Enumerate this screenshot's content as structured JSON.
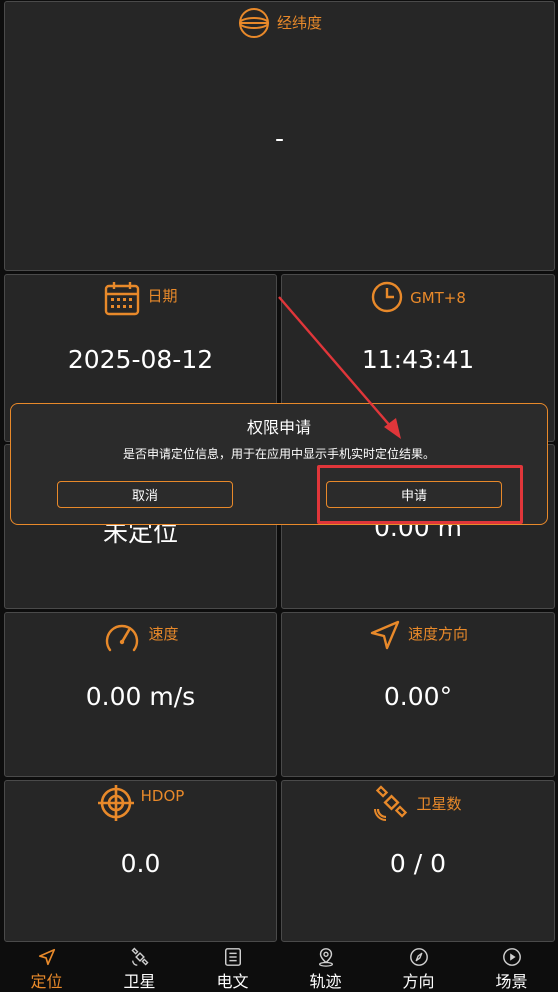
{
  "colors": {
    "accent": "#e8892a",
    "card_bg": "#262626",
    "card_border": "#4a4a4a",
    "highlight": "#e0363a"
  },
  "cards": {
    "latlng": {
      "label": "经纬度",
      "icon": "globe-icon",
      "value": "-"
    },
    "date": {
      "label": "日期",
      "icon": "calendar-icon",
      "value": "2025-08-12"
    },
    "time": {
      "label": "GMT+8",
      "icon": "clock-icon",
      "value": "11:43:41"
    },
    "status": {
      "value": "未定位"
    },
    "altitude": {
      "value": "0.00 m"
    },
    "speed": {
      "label": "速度",
      "icon": "speedometer-icon",
      "value": "0.00 m/s"
    },
    "heading": {
      "label": "速度方向",
      "icon": "navigation-arrow-icon",
      "value": "0.00°"
    },
    "hdop": {
      "label": "HDOP",
      "icon": "crosshair-icon",
      "value": "0.0"
    },
    "satellites": {
      "label": "卫星数",
      "icon": "satellite-icon",
      "value": "0 / 0"
    }
  },
  "dialog": {
    "title": "权限申请",
    "message": "是否申请定位信息，用于在应用中显示手机实时定位结果。",
    "cancel_label": "取消",
    "confirm_label": "申请"
  },
  "nav": [
    {
      "label": "定位",
      "icon": "location-arrow-icon",
      "active": true
    },
    {
      "label": "卫星",
      "icon": "satellite-icon"
    },
    {
      "label": "电文",
      "icon": "document-list-icon"
    },
    {
      "label": "轨迹",
      "icon": "map-pin-icon"
    },
    {
      "label": "方向",
      "icon": "compass-icon"
    },
    {
      "label": "场景",
      "icon": "play-circle-icon"
    }
  ]
}
